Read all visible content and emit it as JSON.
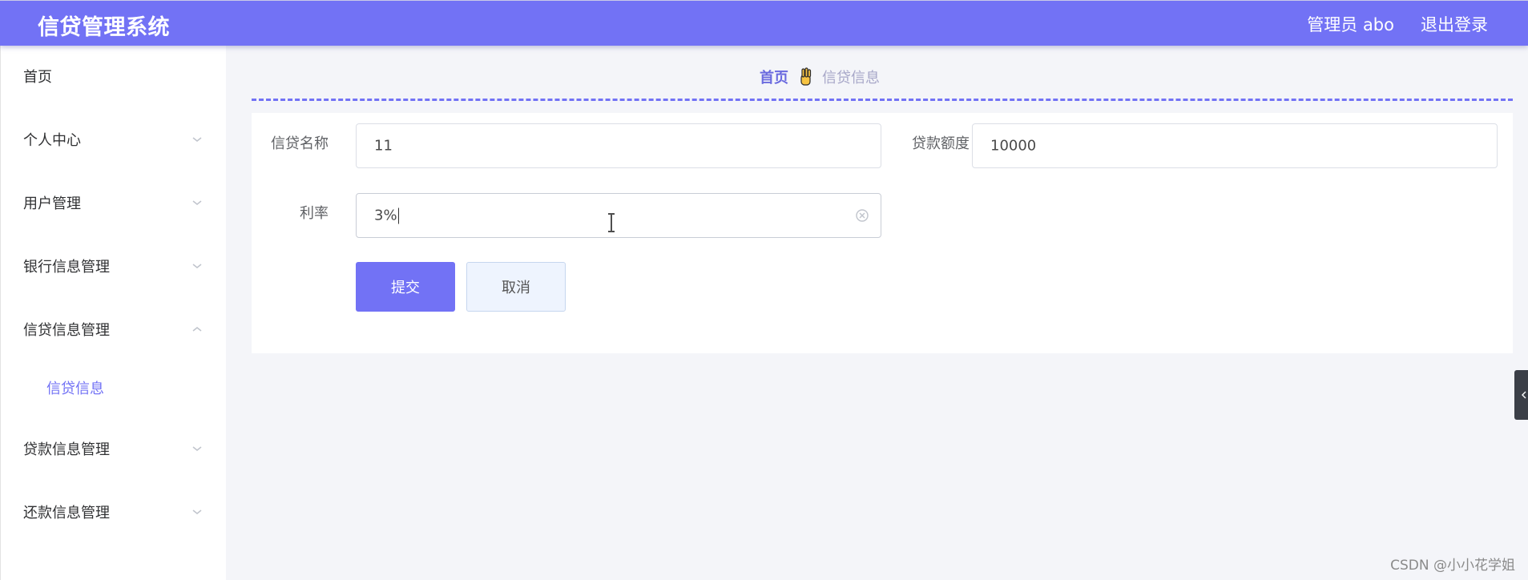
{
  "header": {
    "title": "信贷管理系统",
    "user_label": "管理员 abo",
    "logout_label": "退出登录"
  },
  "sidebar": {
    "items": [
      {
        "label": "首页"
      },
      {
        "label": "个人中心"
      },
      {
        "label": "用户管理"
      },
      {
        "label": "银行信息管理"
      },
      {
        "label": "信贷信息管理"
      },
      {
        "label": "贷款信息管理"
      },
      {
        "label": "还款信息管理"
      }
    ],
    "active_sub": {
      "label": "信贷信息"
    }
  },
  "breadcrumb": {
    "home": "首页",
    "current": "信贷信息"
  },
  "form": {
    "credit_name": {
      "label": "信贷名称",
      "value": "11"
    },
    "loan_amount": {
      "label": "贷款额度",
      "value": "10000"
    },
    "rate": {
      "label": "利率",
      "value": "3%"
    },
    "submit_label": "提交",
    "cancel_label": "取消"
  },
  "watermark": "CSDN @小小花学姐",
  "colors": {
    "accent": "#7272f5",
    "breadcrumb_home": "#6b6bdf",
    "breadcrumb_current": "#a7a7c8"
  },
  "icons": {
    "breadcrumb_separator": "hand-icon",
    "menu_chevron": "chevron-down-icon",
    "menu_chevron_open": "chevron-up-icon",
    "clear": "circle-close-icon",
    "side_toggle": "chevron-left-icon"
  }
}
